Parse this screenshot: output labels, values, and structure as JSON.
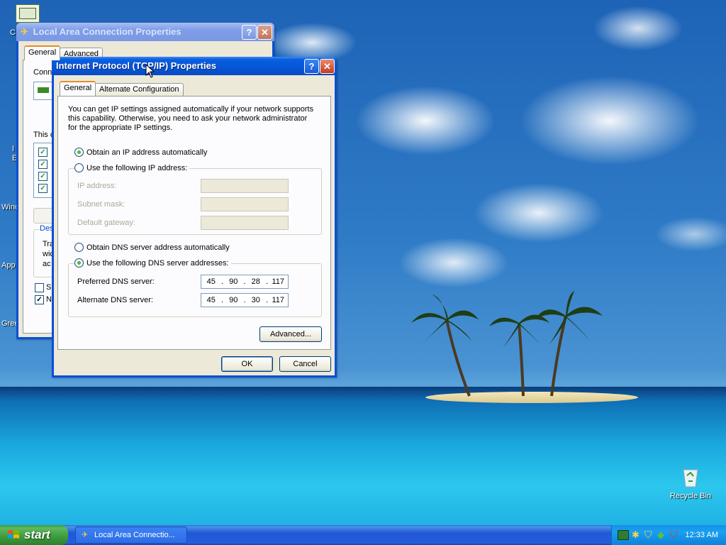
{
  "desktop": {
    "icon_fragments": [
      "C",
      "I",
      "E",
      "Wind",
      "App",
      "Gree"
    ],
    "recycle_bin": "Recycle Bin"
  },
  "lac_window": {
    "title": "Local Area Connection Properties",
    "help_btn": "?",
    "close_btn": "✕",
    "tabs": [
      "General",
      "Advanced"
    ],
    "fragments": [
      "Conn",
      "This c",
      "Des",
      "Tra",
      "wic",
      "ac",
      "Sh",
      "No"
    ],
    "checkboxes_checked": [
      true,
      true,
      true,
      true
    ]
  },
  "tcpip_window": {
    "title": "Internet Protocol (TCP/IP) Properties",
    "help_btn": "?",
    "close_btn": "✕",
    "tabs": [
      "General",
      "Alternate Configuration"
    ],
    "intro": "You can get IP settings assigned automatically if your network supports this capability. Otherwise, you need to ask your network administrator for the appropriate IP settings.",
    "ip_auto": "Obtain an IP address automatically",
    "ip_manual": "Use the following IP address:",
    "ip_auto_selected": true,
    "ip_address_label": "IP address:",
    "subnet_mask_label": "Subnet mask:",
    "default_gateway_label": "Default gateway:",
    "dns_auto": "Obtain DNS server address automatically",
    "dns_manual": "Use the following DNS server addresses:",
    "dns_manual_selected": true,
    "preferred_dns_label": "Preferred DNS server:",
    "preferred_dns": [
      "45",
      "90",
      "28",
      "117"
    ],
    "alternate_dns_label": "Alternate DNS server:",
    "alternate_dns": [
      "45",
      "90",
      "30",
      "117"
    ],
    "advanced_btn": "Advanced...",
    "ok_btn": "OK",
    "cancel_btn": "Cancel"
  },
  "taskbar": {
    "start": "start",
    "task_label": "Local Area Connectio...",
    "clock": "12:33 AM"
  }
}
